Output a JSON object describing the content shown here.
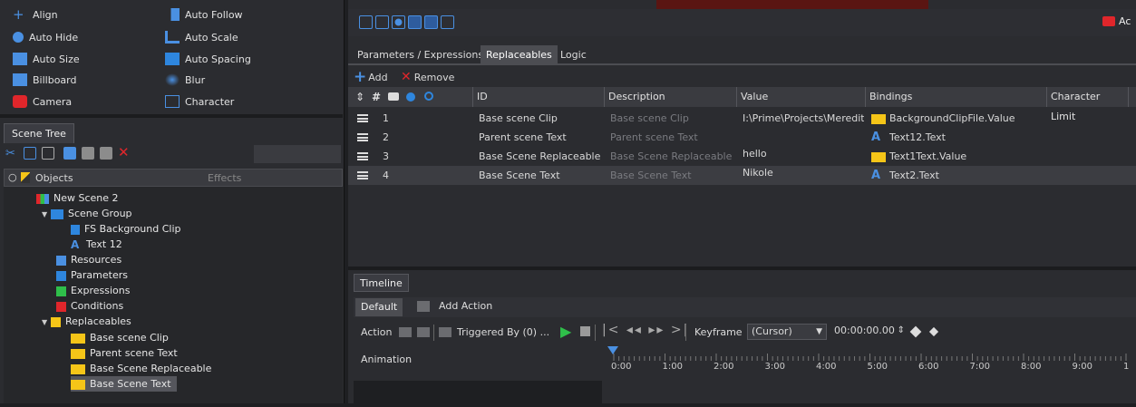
{
  "left_panel": {
    "toolbox": [
      {
        "label": "Align",
        "icon": "plus-icon"
      },
      {
        "label": "Auto Follow",
        "icon": "auto-follow-icon"
      },
      {
        "label": "Auto Hide",
        "icon": "auto-hide-icon"
      },
      {
        "label": "Auto Scale",
        "icon": "auto-scale-icon"
      },
      {
        "label": "Auto Size",
        "icon": "auto-size-icon"
      },
      {
        "label": "Auto Spacing",
        "icon": "auto-spacing-icon"
      },
      {
        "label": "Billboard",
        "icon": "billboard-icon"
      },
      {
        "label": "Blur",
        "icon": "blur-icon"
      },
      {
        "label": "Camera",
        "icon": "camera-icon"
      },
      {
        "label": "Character",
        "icon": "character-icon"
      }
    ],
    "scene_tree_tab": "Scene Tree",
    "tree_header": {
      "objects": "Objects",
      "effects": "Effects"
    },
    "tree": [
      {
        "label": "New Scene 2"
      },
      {
        "label": "Scene Group"
      },
      {
        "label": "FS Background Clip"
      },
      {
        "label": "Text 12"
      },
      {
        "label": "Resources"
      },
      {
        "label": "Parameters"
      },
      {
        "label": "Expressions"
      },
      {
        "label": "Conditions"
      },
      {
        "label": "Replaceables"
      },
      {
        "label": "Base scene Clip"
      },
      {
        "label": "Parent scene Text"
      },
      {
        "label": "Base Scene Replaceable"
      },
      {
        "label": "Base Scene Text"
      }
    ]
  },
  "top_right_label": "Ac",
  "tabs": [
    "Parameters / Expressions",
    "Replaceables",
    "Logic"
  ],
  "active_tab": "Replaceables",
  "actions": {
    "add": "Add",
    "remove": "Remove"
  },
  "grid": {
    "headers": [
      "ID",
      "Description",
      "Value",
      "Bindings",
      "Character Limit"
    ],
    "rows": [
      {
        "num": "1",
        "id": "Base scene Clip",
        "desc": "Base scene Clip",
        "value": "I:\\Prime\\Projects\\Meredith",
        "binding": "BackgroundClipFile.Value",
        "binding_icon": "folder-icon"
      },
      {
        "num": "2",
        "id": "Parent scene Text",
        "desc": "Parent scene Text",
        "value": "",
        "binding": "Text12.Text",
        "binding_icon": "text-icon"
      },
      {
        "num": "3",
        "id": "Base Scene Replaceable",
        "desc": "Base Scene Replaceable",
        "value": "hello",
        "binding": "Text1Text.Value",
        "binding_icon": "folder-icon"
      },
      {
        "num": "4",
        "id": "Base Scene Text",
        "desc": "Base Scene Text",
        "value": "Nikole",
        "binding": "Text2.Text",
        "binding_icon": "text-icon"
      }
    ]
  },
  "timeline": {
    "tab": "Timeline",
    "default_tab": "Default",
    "add_action": "Add Action",
    "action_label": "Action",
    "triggered_by": "Triggered By (0) ...",
    "keyframe_label": "Keyframe",
    "keyframe_value": "(Cursor)",
    "time_value": "00:00:00.00",
    "animation_label": "Animation",
    "ticks": [
      "0:00",
      "1:00",
      "2:00",
      "3:00",
      "4:00",
      "5:00",
      "6:00",
      "7:00",
      "8:00",
      "9:00",
      "1"
    ]
  },
  "colors": {
    "accent": "#4a90e2",
    "folder": "#f5c518",
    "remove": "#e0262b",
    "green": "#2fbf4a",
    "selected": "#3c3d42"
  }
}
